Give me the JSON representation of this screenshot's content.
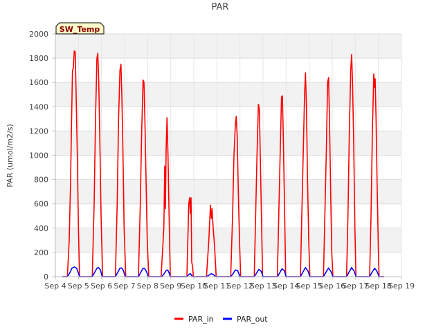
{
  "chart_data": {
    "type": "line",
    "title": "PAR",
    "ylabel": "PAR (umol/m2/s)",
    "xlabel": "",
    "badge": "SW_Temp",
    "ylim": [
      0,
      2000
    ],
    "yticks": [
      0,
      200,
      400,
      600,
      800,
      1000,
      1200,
      1400,
      1600,
      1800,
      2000
    ],
    "xlim": [
      4,
      19
    ],
    "xticks": [
      {
        "value": 4,
        "label": "Sep 4"
      },
      {
        "value": 5,
        "label": "Sep 5"
      },
      {
        "value": 6,
        "label": "Sep 6"
      },
      {
        "value": 7,
        "label": "Sep 7"
      },
      {
        "value": 8,
        "label": "Sep 8"
      },
      {
        "value": 9,
        "label": "Sep 9"
      },
      {
        "value": 10,
        "label": "Sep 10"
      },
      {
        "value": 11,
        "label": "Sep 11"
      },
      {
        "value": 12,
        "label": "Sep 12"
      },
      {
        "value": 13,
        "label": "Sep 13"
      },
      {
        "value": 14,
        "label": "Sep 14"
      },
      {
        "value": 15,
        "label": "Sep 15"
      },
      {
        "value": 16,
        "label": "Sep 16"
      },
      {
        "value": 17,
        "label": "Sep 17"
      },
      {
        "value": 18,
        "label": "Sep 18"
      },
      {
        "value": 19,
        "label": "Sep 19"
      }
    ],
    "grid": true,
    "legend_position": "bottom-center",
    "series": [
      {
        "name": "PAR_in",
        "color": "#ff0000",
        "points": [
          [
            4.3,
            0
          ],
          [
            4.52,
            0
          ],
          [
            4.6,
            300
          ],
          [
            4.66,
            800
          ],
          [
            4.7,
            1250
          ],
          [
            4.74,
            1700
          ],
          [
            4.78,
            1720
          ],
          [
            4.82,
            1860
          ],
          [
            4.86,
            1850
          ],
          [
            4.9,
            1500
          ],
          [
            4.95,
            1000
          ],
          [
            5.0,
            400
          ],
          [
            5.05,
            0
          ],
          [
            5.6,
            0
          ],
          [
            5.68,
            600
          ],
          [
            5.74,
            1300
          ],
          [
            5.8,
            1800
          ],
          [
            5.84,
            1840
          ],
          [
            5.88,
            1600
          ],
          [
            5.93,
            1100
          ],
          [
            5.98,
            500
          ],
          [
            6.05,
            0
          ],
          [
            6.6,
            0
          ],
          [
            6.68,
            600
          ],
          [
            6.74,
            1300
          ],
          [
            6.8,
            1700
          ],
          [
            6.84,
            1750
          ],
          [
            6.88,
            1500
          ],
          [
            6.93,
            1000
          ],
          [
            6.98,
            400
          ],
          [
            7.05,
            0
          ],
          [
            7.6,
            0
          ],
          [
            7.68,
            600
          ],
          [
            7.74,
            1200
          ],
          [
            7.8,
            1620
          ],
          [
            7.84,
            1600
          ],
          [
            7.88,
            1300
          ],
          [
            7.93,
            800
          ],
          [
            7.98,
            300
          ],
          [
            8.05,
            0
          ],
          [
            8.58,
            0
          ],
          [
            8.64,
            200
          ],
          [
            8.7,
            400
          ],
          [
            8.74,
            910
          ],
          [
            8.77,
            560
          ],
          [
            8.8,
            1050
          ],
          [
            8.84,
            1310
          ],
          [
            8.88,
            1000
          ],
          [
            8.93,
            500
          ],
          [
            8.98,
            0
          ],
          [
            9.7,
            0
          ],
          [
            9.78,
            600
          ],
          [
            9.82,
            650
          ],
          [
            9.85,
            520
          ],
          [
            9.88,
            650
          ],
          [
            9.91,
            120
          ],
          [
            9.95,
            80
          ],
          [
            9.98,
            0
          ],
          [
            10.55,
            0
          ],
          [
            10.65,
            300
          ],
          [
            10.72,
            590
          ],
          [
            10.76,
            480
          ],
          [
            10.79,
            560
          ],
          [
            10.84,
            400
          ],
          [
            10.9,
            250
          ],
          [
            10.97,
            0
          ],
          [
            11.6,
            0
          ],
          [
            11.68,
            500
          ],
          [
            11.74,
            1000
          ],
          [
            11.8,
            1250
          ],
          [
            11.84,
            1320
          ],
          [
            11.88,
            1150
          ],
          [
            11.93,
            700
          ],
          [
            11.98,
            300
          ],
          [
            12.03,
            0
          ],
          [
            12.62,
            0
          ],
          [
            12.68,
            500
          ],
          [
            12.74,
            1000
          ],
          [
            12.8,
            1420
          ],
          [
            12.84,
            1380
          ],
          [
            12.88,
            1000
          ],
          [
            12.93,
            500
          ],
          [
            12.98,
            0
          ],
          [
            13.62,
            0
          ],
          [
            13.68,
            500
          ],
          [
            13.74,
            1000
          ],
          [
            13.8,
            1480
          ],
          [
            13.84,
            1490
          ],
          [
            13.88,
            1150
          ],
          [
            13.93,
            600
          ],
          [
            13.98,
            0
          ],
          [
            14.62,
            0
          ],
          [
            14.68,
            500
          ],
          [
            14.74,
            1000
          ],
          [
            14.8,
            1500
          ],
          [
            14.84,
            1680
          ],
          [
            14.88,
            1400
          ],
          [
            14.93,
            800
          ],
          [
            14.98,
            300
          ],
          [
            15.03,
            0
          ],
          [
            15.62,
            0
          ],
          [
            15.68,
            500
          ],
          [
            15.74,
            1000
          ],
          [
            15.8,
            1600
          ],
          [
            15.84,
            1640
          ],
          [
            15.88,
            1300
          ],
          [
            15.93,
            700
          ],
          [
            15.98,
            200
          ],
          [
            16.03,
            0
          ],
          [
            16.62,
            0
          ],
          [
            16.68,
            500
          ],
          [
            16.74,
            1200
          ],
          [
            16.8,
            1700
          ],
          [
            16.84,
            1830
          ],
          [
            16.88,
            1600
          ],
          [
            16.93,
            1100
          ],
          [
            16.98,
            400
          ],
          [
            17.03,
            0
          ],
          [
            17.62,
            0
          ],
          [
            17.68,
            500
          ],
          [
            17.74,
            1200
          ],
          [
            17.8,
            1670
          ],
          [
            17.83,
            1560
          ],
          [
            17.86,
            1630
          ],
          [
            17.9,
            1300
          ],
          [
            17.95,
            700
          ],
          [
            18.0,
            200
          ],
          [
            18.03,
            0
          ],
          [
            18.25,
            0
          ]
        ]
      },
      {
        "name": "PAR_out",
        "color": "#0000ff",
        "points": [
          [
            4.3,
            0
          ],
          [
            4.52,
            0
          ],
          [
            4.62,
            30
          ],
          [
            4.72,
            70
          ],
          [
            4.82,
            80
          ],
          [
            4.92,
            70
          ],
          [
            5.0,
            30
          ],
          [
            5.05,
            0
          ],
          [
            5.6,
            0
          ],
          [
            5.7,
            35
          ],
          [
            5.8,
            70
          ],
          [
            5.87,
            75
          ],
          [
            5.95,
            55
          ],
          [
            6.03,
            0
          ],
          [
            6.6,
            0
          ],
          [
            6.7,
            35
          ],
          [
            6.8,
            70
          ],
          [
            6.87,
            72
          ],
          [
            6.95,
            50
          ],
          [
            7.03,
            0
          ],
          [
            7.6,
            0
          ],
          [
            7.7,
            35
          ],
          [
            7.8,
            70
          ],
          [
            7.87,
            68
          ],
          [
            7.95,
            40
          ],
          [
            8.03,
            0
          ],
          [
            8.6,
            0
          ],
          [
            8.7,
            20
          ],
          [
            8.8,
            50
          ],
          [
            8.87,
            55
          ],
          [
            8.94,
            25
          ],
          [
            8.98,
            0
          ],
          [
            9.7,
            0
          ],
          [
            9.8,
            20
          ],
          [
            9.86,
            25
          ],
          [
            9.9,
            10
          ],
          [
            9.95,
            0
          ],
          [
            10.55,
            0
          ],
          [
            10.68,
            15
          ],
          [
            10.76,
            25
          ],
          [
            10.86,
            15
          ],
          [
            10.95,
            0
          ],
          [
            11.6,
            0
          ],
          [
            11.7,
            25
          ],
          [
            11.8,
            55
          ],
          [
            11.9,
            50
          ],
          [
            12.0,
            0
          ],
          [
            12.62,
            0
          ],
          [
            12.72,
            30
          ],
          [
            12.82,
            60
          ],
          [
            12.92,
            45
          ],
          [
            13.0,
            0
          ],
          [
            13.62,
            0
          ],
          [
            13.72,
            30
          ],
          [
            13.82,
            65
          ],
          [
            13.92,
            50
          ],
          [
            14.0,
            0
          ],
          [
            14.62,
            0
          ],
          [
            14.72,
            35
          ],
          [
            14.84,
            75
          ],
          [
            14.95,
            45
          ],
          [
            15.03,
            0
          ],
          [
            15.62,
            0
          ],
          [
            15.72,
            35
          ],
          [
            15.84,
            72
          ],
          [
            15.95,
            40
          ],
          [
            16.03,
            0
          ],
          [
            16.62,
            0
          ],
          [
            16.72,
            35
          ],
          [
            16.84,
            75
          ],
          [
            16.95,
            45
          ],
          [
            17.03,
            0
          ],
          [
            17.62,
            0
          ],
          [
            17.72,
            35
          ],
          [
            17.84,
            70
          ],
          [
            17.95,
            40
          ],
          [
            18.03,
            0
          ],
          [
            18.25,
            0
          ]
        ]
      }
    ]
  }
}
